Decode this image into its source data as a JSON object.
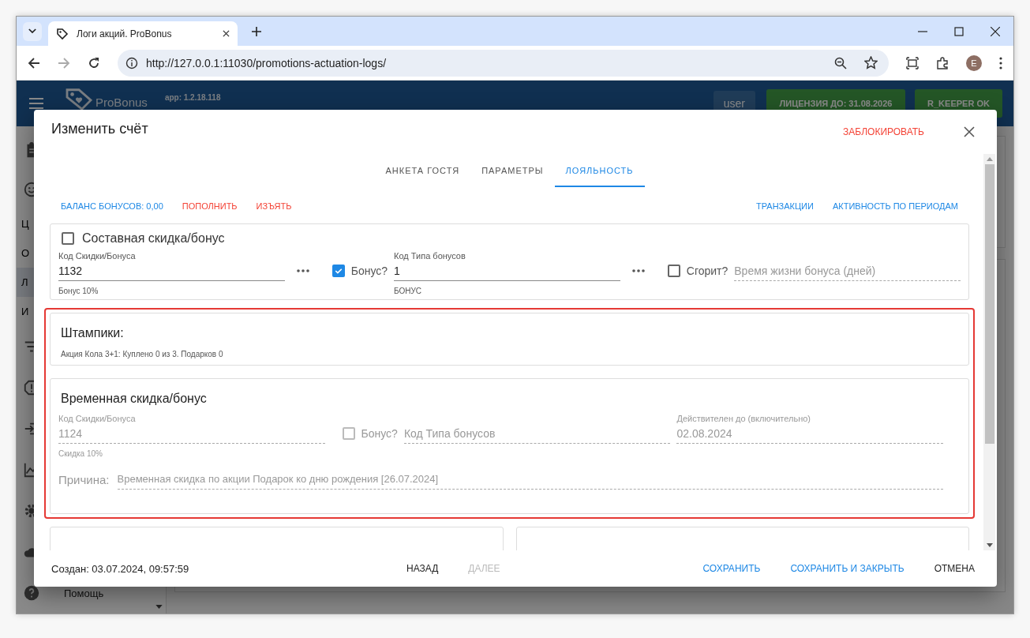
{
  "browser": {
    "tab_title": "Логи акций. ProBonus",
    "url": "http://127.0.0.1:11030/promotions-actuation-logs/",
    "avatar": "E"
  },
  "app": {
    "logo": "ProBonus",
    "version": "app: 1.2.18.118",
    "user": "user",
    "license": "ЛИЦЕНЗИЯ ДО: 31.08.2026",
    "pos_status": "R_KEEPER OK",
    "sidebar": {
      "items": [
        {
          "kind": "icon"
        },
        {
          "kind": "icon"
        },
        {
          "kind": "text",
          "label": "Ц",
          "selected": false
        },
        {
          "kind": "text",
          "label": "О",
          "selected": false
        },
        {
          "kind": "text",
          "label": "Л",
          "selected": true
        },
        {
          "kind": "text",
          "label": "И",
          "selected": false
        },
        {
          "kind": "icon"
        },
        {
          "kind": "icon"
        },
        {
          "kind": "icon"
        },
        {
          "kind": "icon"
        },
        {
          "kind": "icon"
        },
        {
          "kind": "icon"
        },
        {
          "kind": "icon_text",
          "label": "Помощь"
        }
      ]
    }
  },
  "dialog": {
    "title": "Изменить счёт",
    "block_button": "ЗАБЛОКИРОВАТЬ",
    "tabs": [
      {
        "label": "АНКЕТА ГОСТЯ",
        "selected": false
      },
      {
        "label": "ПАРАМЕТРЫ",
        "selected": false
      },
      {
        "label": "ЛОЯЛЬНОСТЬ",
        "selected": true
      }
    ],
    "actions_left": [
      {
        "label": "БАЛАНС БОНУСОВ: 0,00",
        "kind": "info"
      },
      {
        "label": "ПОПОЛНИТЬ",
        "kind": "danger"
      },
      {
        "label": "ИЗЪЯТЬ",
        "kind": "danger"
      }
    ],
    "actions_right": [
      {
        "label": "ТРАНЗАКЦИИ",
        "kind": "info"
      },
      {
        "label": "АКТИВНОСТЬ ПО ПЕРИОДАМ",
        "kind": "info"
      }
    ],
    "composite": {
      "title": "Составная скидка/бонус",
      "checked": false,
      "row": [
        {
          "kind": "field",
          "label": "Код Скидки/Бонуса",
          "value": "1132",
          "helper": "Бонус 10%",
          "disabled": false
        },
        {
          "kind": "more"
        },
        {
          "kind": "checkbox",
          "label": "Бонус?",
          "checked": true,
          "disabled": false
        },
        {
          "kind": "field",
          "label": "Код Типа бонусов",
          "value": "1",
          "helper": "БОНУС",
          "disabled": false
        },
        {
          "kind": "more"
        },
        {
          "kind": "checkbox",
          "label": "Сгорит?",
          "checked": false,
          "disabled": false
        },
        {
          "kind": "field",
          "placeholder": "Время жизни бонуса (дней)",
          "disabled": true
        }
      ]
    },
    "stamps": {
      "title": "Штампики:",
      "lines": [
        "Акция Кола 3+1: Куплено 0 из 3. Подарков 0"
      ]
    },
    "temporary": {
      "title": "Временная скидка/бонус",
      "row": [
        {
          "kind": "field",
          "label": "Код Скидки/Бонуса",
          "value": "1124",
          "helper": "Скидка 10%",
          "disabled": true
        },
        {
          "kind": "checkbox",
          "label": "Бонус?",
          "checked": false,
          "disabled": true
        },
        {
          "kind": "field",
          "placeholder": "Код Типа бонусов",
          "disabled": true
        },
        {
          "kind": "field",
          "label": "Действителен до (включительно)",
          "value": "02.08.2024",
          "disabled": true
        }
      ],
      "reason": {
        "label": "Причина:",
        "value": "Временная скидка по акции Подарок ко дню рождения [26.07.2024]",
        "disabled": true
      }
    },
    "created": "Создан: 03.07.2024, 09:57:59",
    "nav_buttons": [
      {
        "label": "НАЗАД",
        "disabled": false
      },
      {
        "label": "ДАЛЕЕ",
        "disabled": true
      }
    ],
    "buttons": [
      {
        "label": "СОХРАНИТЬ",
        "kind": "primary"
      },
      {
        "label": "СОХРАНИТЬ И ЗАКРЫТЬ",
        "kind": "primary"
      },
      {
        "label": "ОТМЕНА",
        "kind": "default"
      }
    ]
  }
}
